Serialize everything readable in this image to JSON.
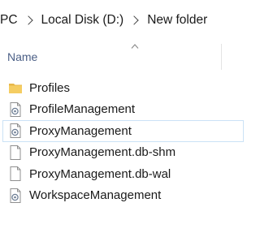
{
  "breadcrumb": {
    "items": [
      "PC",
      "Local Disk (D:)",
      "New folder"
    ]
  },
  "header": {
    "name_label": "Name"
  },
  "files": [
    {
      "label": "Profiles",
      "icon": "folder-icon"
    },
    {
      "label": "ProfileManagement",
      "icon": "file-gear-icon"
    },
    {
      "label": "ProxyManagement",
      "icon": "file-gear-icon"
    },
    {
      "label": "ProxyManagement.db-shm",
      "icon": "file-icon"
    },
    {
      "label": "ProxyManagement.db-wal",
      "icon": "file-icon"
    },
    {
      "label": "WorkspaceManagement",
      "icon": "file-gear-icon"
    }
  ],
  "colors": {
    "header_text": "#4b5f86",
    "hover_border": "#cbe2f6",
    "folder": "#f2c75c"
  }
}
